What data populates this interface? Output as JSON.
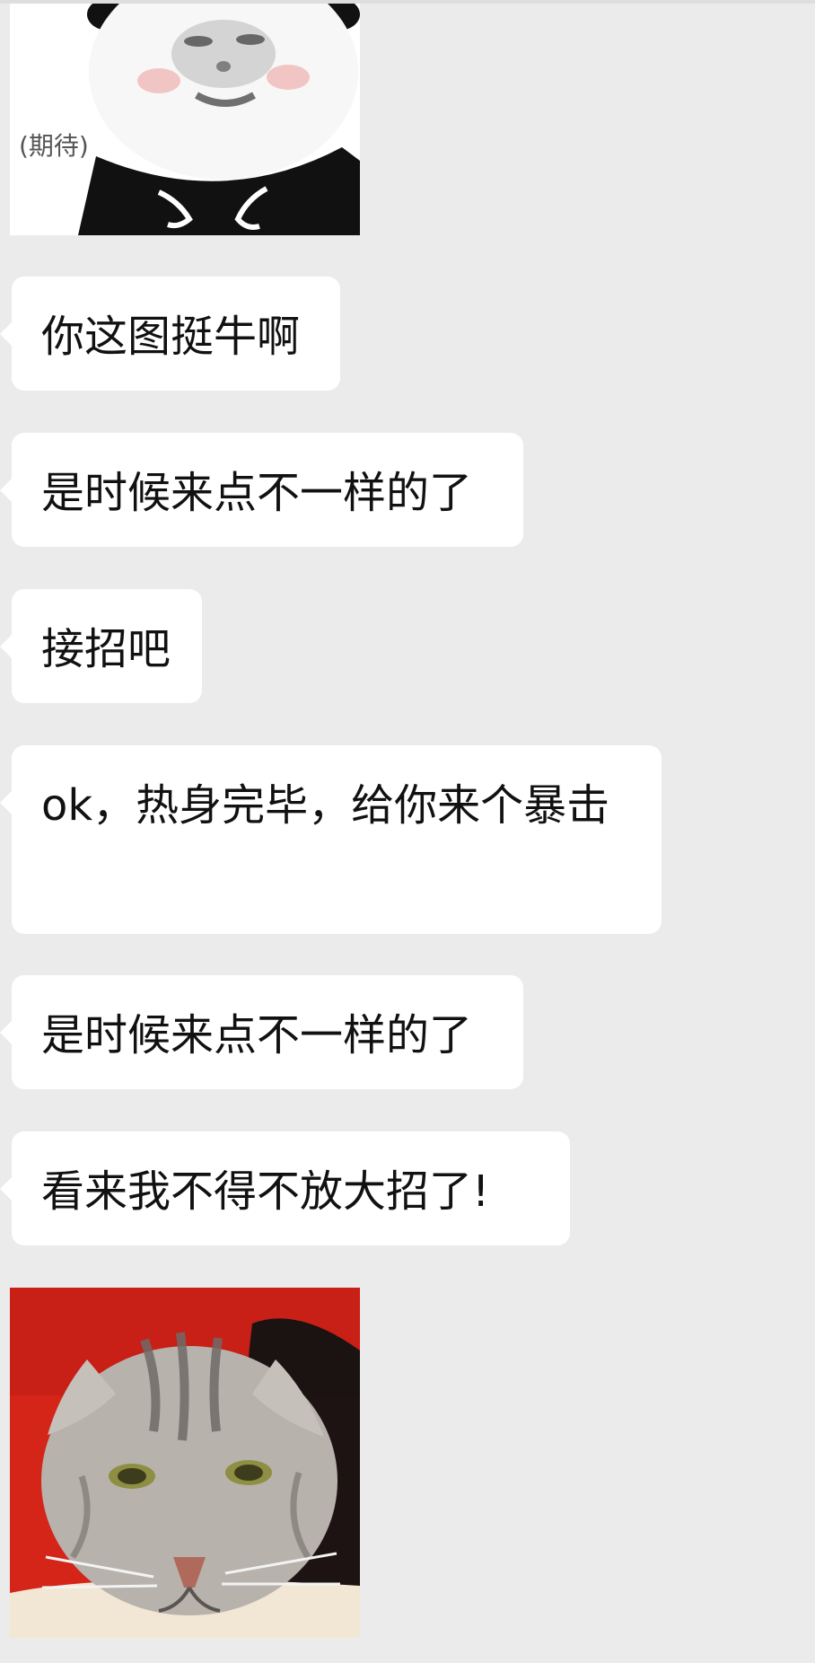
{
  "messages": [
    {
      "type": "sticker",
      "name": "panda-meme",
      "caption": "(期待)"
    },
    {
      "type": "text",
      "text": "你这图挺牛啊"
    },
    {
      "type": "text",
      "text": "是时候来点不一样的了"
    },
    {
      "type": "text",
      "text": "接招吧"
    },
    {
      "type": "text",
      "text": "ok，热身完毕，给你来个暴击"
    },
    {
      "type": "text",
      "text": "是时候来点不一样的了"
    },
    {
      "type": "text",
      "text": "看来我不得不放大招了!"
    },
    {
      "type": "sticker",
      "name": "cat-photo"
    }
  ],
  "colors": {
    "background": "#ebebeb",
    "bubble": "#ffffff",
    "text": "#111111"
  }
}
